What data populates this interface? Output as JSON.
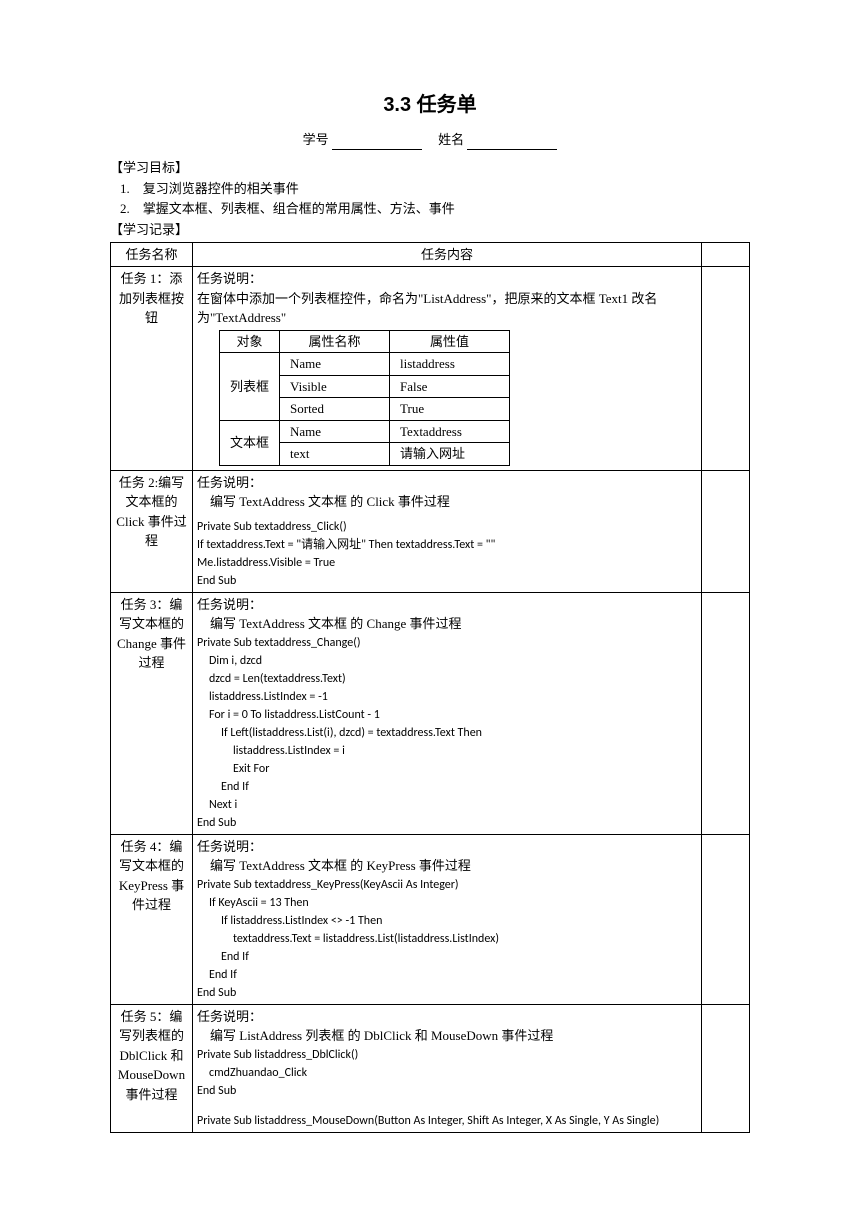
{
  "title": "3.3  任务单",
  "meta": {
    "xuehao_label": "学号",
    "xingming_label": "姓名"
  },
  "goals": {
    "heading": "【学习目标】",
    "items": [
      "1.　复习浏览器控件的相关事件",
      "2.　掌握文本框、列表框、组合框的常用属性、方法、事件"
    ],
    "record_heading": "【学习记录】"
  },
  "table_head": {
    "col1": "任务名称",
    "col2": "任务内容"
  },
  "task1": {
    "name": "任务 1：添加列表框按钮",
    "desc_label": "任务说明：",
    "desc": "在窗体中添加一个列表框控件，命名为\"ListAddress\"，把原来的文本框 Text1 改名为\"TextAddress\"",
    "inner_head": {
      "c1": "对象",
      "c2": "属性名称",
      "c3": "属性值"
    },
    "rows": {
      "r1o": "列表框",
      "r1a": "Name",
      "r1v": "listaddress",
      "r2a": "Visible",
      "r2v": "False",
      "r3a": "Sorted",
      "r3v": "True",
      "r4o": "文本框",
      "r4a": "Name",
      "r4v": "Textaddress",
      "r5a": "text",
      "r5v": "请输入网址"
    }
  },
  "task2": {
    "name": "任务 2:编写文本框的 Click 事件过程",
    "desc_label": "任务说明：",
    "desc": "编写 TextAddress 文本框 的 Click 事件过程",
    "code": [
      "Private Sub textaddress_Click()",
      "    If textaddress.Text = \"请输入网址\" Then textaddress.Text = \"\"",
      "    Me.listaddress.Visible = True",
      "End Sub"
    ]
  },
  "task3": {
    "name": "任务 3：编写文本框的 Change 事件过程",
    "desc_label": "任务说明：",
    "desc": "编写 TextAddress 文本框 的 Change 事件过程",
    "code": [
      "Private Sub textaddress_Change()",
      "    Dim i, dzcd",
      "    dzcd = Len(textaddress.Text)",
      "    listaddress.ListIndex = -1",
      "    For i = 0 To listaddress.ListCount - 1",
      "        If Left(listaddress.List(i), dzcd) = textaddress.Text Then",
      "            listaddress.ListIndex = i",
      "            Exit For",
      "        End If",
      "    Next i",
      "End Sub"
    ]
  },
  "task4": {
    "name": "任务 4：编写文本框的 KeyPress 事件过程",
    "desc_label": "任务说明：",
    "desc": "编写 TextAddress 文本框 的 KeyPress 事件过程",
    "code": [
      "Private Sub textaddress_KeyPress(KeyAscii As Integer)",
      "    If KeyAscii = 13 Then",
      "        If listaddress.ListIndex <> -1 Then",
      "            textaddress.Text = listaddress.List(listaddress.ListIndex)",
      "        End If",
      "    End If",
      "End Sub"
    ]
  },
  "task5": {
    "name": "任务 5：编写列表框的 DblClick 和 MouseDown 事件过程",
    "desc_label": "任务说明：",
    "desc": "编写 ListAddress 列表框 的 DblClick 和 MouseDown 事件过程",
    "code1": [
      "Private Sub listaddress_DblClick()",
      "    cmdZhuandao_Click",
      "End Sub"
    ],
    "code2": [
      "Private Sub listaddress_MouseDown(Button As Integer, Shift As Integer, X As Single, Y As Single)"
    ]
  }
}
